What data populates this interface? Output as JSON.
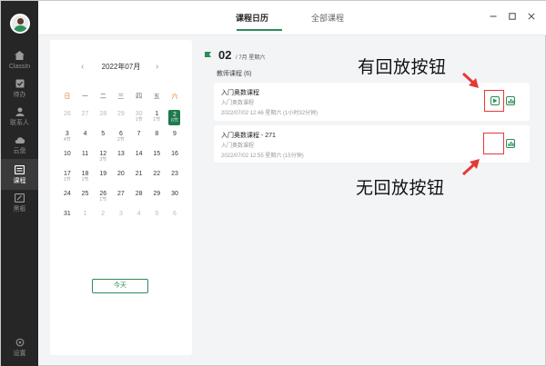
{
  "sidebar": {
    "items": [
      {
        "label": "ClassIn",
        "icon": "home-icon"
      },
      {
        "label": "待办",
        "icon": "checkbox-icon"
      },
      {
        "label": "联系人",
        "icon": "contacts-icon"
      },
      {
        "label": "云盘",
        "icon": "cloud-icon"
      },
      {
        "label": "课程",
        "icon": "course-icon"
      },
      {
        "label": "黑板",
        "icon": "blackboard-icon"
      }
    ],
    "settings_label": "设置"
  },
  "header": {
    "tabs": [
      {
        "label": "课程日历"
      },
      {
        "label": "全部课程"
      }
    ]
  },
  "calendar": {
    "month_label": "2022年07月",
    "weekdays": [
      "日",
      "一",
      "二",
      "三",
      "四",
      "五",
      "六"
    ],
    "weeks": [
      [
        {
          "d": "26",
          "s": ""
        },
        {
          "d": "27",
          "s": ""
        },
        {
          "d": "28",
          "s": ""
        },
        {
          "d": "29",
          "s": ""
        },
        {
          "d": "30",
          "s": "1节"
        },
        {
          "d": "1",
          "s": "1节"
        },
        {
          "d": "2",
          "s": "6节"
        }
      ],
      [
        {
          "d": "3",
          "s": "4节"
        },
        {
          "d": "4",
          "s": ""
        },
        {
          "d": "5",
          "s": ""
        },
        {
          "d": "6",
          "s": "2节"
        },
        {
          "d": "7",
          "s": ""
        },
        {
          "d": "8",
          "s": ""
        },
        {
          "d": "9",
          "s": ""
        }
      ],
      [
        {
          "d": "10",
          "s": ""
        },
        {
          "d": "11",
          "s": ""
        },
        {
          "d": "12",
          "s": "3节"
        },
        {
          "d": "13",
          "s": ""
        },
        {
          "d": "14",
          "s": ""
        },
        {
          "d": "15",
          "s": ""
        },
        {
          "d": "16",
          "s": ""
        }
      ],
      [
        {
          "d": "17",
          "s": "1节"
        },
        {
          "d": "18",
          "s": "1节"
        },
        {
          "d": "19",
          "s": ""
        },
        {
          "d": "20",
          "s": ""
        },
        {
          "d": "21",
          "s": ""
        },
        {
          "d": "22",
          "s": ""
        },
        {
          "d": "23",
          "s": ""
        }
      ],
      [
        {
          "d": "24",
          "s": ""
        },
        {
          "d": "25",
          "s": ""
        },
        {
          "d": "26",
          "s": "1节"
        },
        {
          "d": "27",
          "s": ""
        },
        {
          "d": "28",
          "s": ""
        },
        {
          "d": "29",
          "s": ""
        },
        {
          "d": "30",
          "s": ""
        }
      ],
      [
        {
          "d": "31",
          "s": ""
        },
        {
          "d": "1",
          "s": ""
        },
        {
          "d": "2",
          "s": ""
        },
        {
          "d": "3",
          "s": ""
        },
        {
          "d": "4",
          "s": ""
        },
        {
          "d": "5",
          "s": ""
        },
        {
          "d": "6",
          "s": ""
        }
      ]
    ],
    "today_label": "今天"
  },
  "day": {
    "number": "02",
    "sub": "/ 7月 星期六",
    "section": "教师课程 (6)"
  },
  "courses": [
    {
      "title": "入门奥数课程",
      "sub": "入门奥数课程",
      "meta": "2022/07/02 12:46 星期六 (1小时32分钟)"
    },
    {
      "title": "入门奥数课程 - 271",
      "sub": "入门奥数课程",
      "meta": "2022/07/02 12:55 星期六 (15分钟)"
    }
  ],
  "annotations": {
    "has_replay": "有回放按钮",
    "no_replay": "无回放按钮"
  },
  "colors": {
    "accent": "#2e8b57",
    "highlight": "#e53935"
  }
}
